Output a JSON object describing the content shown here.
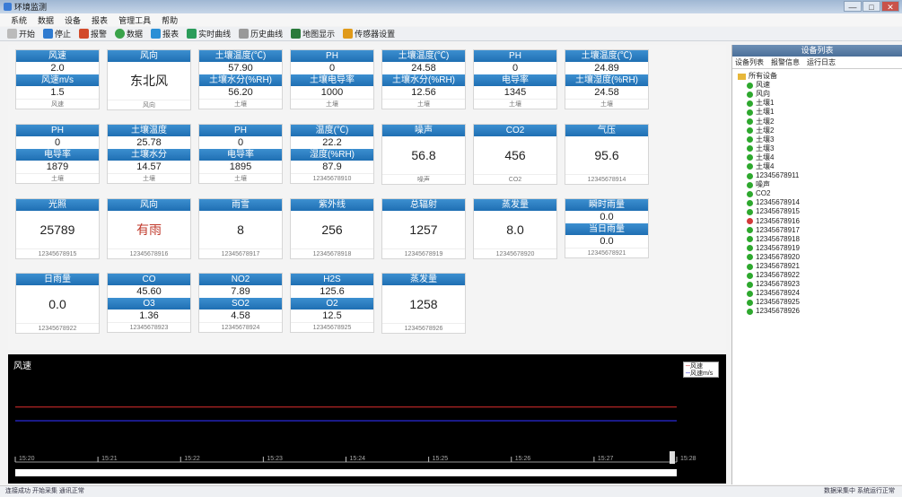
{
  "app": {
    "title": "环境监测",
    "window_buttons": [
      "—",
      "□",
      "✕"
    ]
  },
  "menu": [
    "系统",
    "数据",
    "设备",
    "报表",
    "管理工具",
    "帮助"
  ],
  "toolbar": {
    "start": "开始",
    "stop": "停止",
    "alarm": "报警",
    "data": "数据",
    "report": "报表",
    "curve": "实时曲线",
    "history": "历史曲线",
    "map": "地图显示",
    "settings": "传感器设置"
  },
  "cards": [
    {
      "rows": [
        [
          "h",
          "风速"
        ],
        [
          "v",
          "2.0"
        ],
        [
          "h",
          "风速m/s"
        ],
        [
          "v",
          "1.5"
        ],
        [
          "f",
          "风速"
        ]
      ]
    },
    {
      "rows": [
        [
          "h",
          "风向"
        ],
        [
          "big",
          "东北风"
        ],
        [
          "f",
          "风向"
        ]
      ]
    },
    {
      "rows": [
        [
          "h",
          "土壤温度(℃)"
        ],
        [
          "v",
          "57.90"
        ],
        [
          "h",
          "土壤水分(%RH)"
        ],
        [
          "v",
          "56.20"
        ],
        [
          "f",
          "土壤"
        ]
      ]
    },
    {
      "rows": [
        [
          "h",
          "PH"
        ],
        [
          "v",
          "0"
        ],
        [
          "h",
          "土壤电导率"
        ],
        [
          "v",
          "1000"
        ],
        [
          "f",
          "土壤"
        ]
      ]
    },
    {
      "rows": [
        [
          "h",
          "土壤温度(℃)"
        ],
        [
          "v",
          "24.58"
        ],
        [
          "h",
          "土壤水分(%RH)"
        ],
        [
          "v",
          "12.56"
        ],
        [
          "f",
          "土壤"
        ]
      ]
    },
    {
      "rows": [
        [
          "h",
          "PH"
        ],
        [
          "v",
          "0"
        ],
        [
          "h",
          "电导率"
        ],
        [
          "v",
          "1345"
        ],
        [
          "f",
          "土壤"
        ]
      ]
    },
    {
      "rows": [
        [
          "h",
          "土壤温度(℃)"
        ],
        [
          "v",
          "24.89"
        ],
        [
          "h",
          "土壤湿度(%RH)"
        ],
        [
          "v",
          "24.58"
        ],
        [
          "f",
          "土壤"
        ]
      ]
    },
    {
      "rows": [
        [
          "h",
          "PH"
        ],
        [
          "v",
          "0"
        ],
        [
          "h",
          "电导率"
        ],
        [
          "v",
          "1879"
        ],
        [
          "f",
          "土壤"
        ]
      ]
    },
    {
      "rows": [
        [
          "h",
          "土壤温度"
        ],
        [
          "v",
          "25.78"
        ],
        [
          "h",
          "土壤水分"
        ],
        [
          "v",
          "14.57"
        ],
        [
          "f",
          "土壤"
        ]
      ]
    },
    {
      "rows": [
        [
          "h",
          "PH"
        ],
        [
          "v",
          "0"
        ],
        [
          "h",
          "电导率"
        ],
        [
          "v",
          "1895"
        ],
        [
          "f",
          "土壤"
        ]
      ]
    },
    {
      "rows": [
        [
          "h",
          "温度(℃)"
        ],
        [
          "v",
          "22.2"
        ],
        [
          "h",
          "湿度(%RH)"
        ],
        [
          "v",
          "87.9"
        ],
        [
          "f",
          "12345678910"
        ]
      ]
    },
    {
      "rows": [
        [
          "h",
          "噪声"
        ],
        [
          "big",
          "56.8"
        ],
        [
          "f",
          "噪声"
        ]
      ]
    },
    {
      "rows": [
        [
          "h",
          "CO2"
        ],
        [
          "big",
          "456"
        ],
        [
          "f",
          "CO2"
        ]
      ]
    },
    {
      "rows": [
        [
          "h",
          "气压"
        ],
        [
          "big",
          "95.6"
        ],
        [
          "f",
          "12345678914"
        ]
      ]
    },
    {
      "rows": [
        [
          "h",
          "光照"
        ],
        [
          "big",
          "25789"
        ],
        [
          "f",
          "12345678915"
        ]
      ]
    },
    {
      "rows": [
        [
          "h",
          "风向"
        ],
        [
          "big",
          "有雨"
        ],
        [
          "f",
          "12345678916"
        ]
      ]
    },
    {
      "rows": [
        [
          "h",
          "雨雪"
        ],
        [
          "big",
          "8"
        ],
        [
          "f",
          "12345678917"
        ]
      ]
    },
    {
      "rows": [
        [
          "h",
          "紫外线"
        ],
        [
          "big",
          "256"
        ],
        [
          "f",
          "12345678918"
        ]
      ]
    },
    {
      "rows": [
        [
          "h",
          "总辐射"
        ],
        [
          "big",
          "1257"
        ],
        [
          "f",
          "12345678919"
        ]
      ]
    },
    {
      "rows": [
        [
          "h",
          "蒸发量"
        ],
        [
          "big",
          "8.0"
        ],
        [
          "f",
          "12345678920"
        ]
      ]
    },
    {
      "rows": [
        [
          "h",
          "瞬时雨量"
        ],
        [
          "v",
          "0.0"
        ],
        [
          "h",
          "当日雨量"
        ],
        [
          "v",
          "0.0"
        ],
        [
          "f",
          "12345678921"
        ]
      ]
    },
    {
      "rows": [
        [
          "h",
          "日雨量"
        ],
        [
          "big",
          "0.0"
        ],
        [
          "f",
          "12345678922"
        ]
      ]
    },
    {
      "rows": [
        [
          "h",
          "CO"
        ],
        [
          "v",
          "45.60"
        ],
        [
          "h",
          "O3"
        ],
        [
          "v",
          "1.36"
        ],
        [
          "f",
          "12345678923"
        ]
      ]
    },
    {
      "rows": [
        [
          "h",
          "NO2"
        ],
        [
          "v",
          "7.89"
        ],
        [
          "h",
          "SO2"
        ],
        [
          "v",
          "4.58"
        ],
        [
          "f",
          "12345678924"
        ]
      ]
    },
    {
      "rows": [
        [
          "h",
          "H2S"
        ],
        [
          "v",
          "125.6"
        ],
        [
          "h",
          "O2"
        ],
        [
          "v",
          "12.5"
        ],
        [
          "f",
          "12345678925"
        ]
      ]
    },
    {
      "rows": [
        [
          "h",
          "蒸发量"
        ],
        [
          "big",
          "1258"
        ],
        [
          "f",
          "12345678926"
        ]
      ]
    }
  ],
  "right_panel": {
    "title": "设备列表",
    "tabs": [
      "设备列表",
      "报警信息",
      "运行日志"
    ],
    "root": "所有设备",
    "items": [
      "风速",
      "风向",
      "土壤1",
      "土壤1",
      "土壤2",
      "土壤2",
      "土壤3",
      "土壤3",
      "土壤4",
      "土壤4",
      "12345678911",
      "噪声",
      "CO2",
      "12345678914",
      "12345678915",
      "12345678916",
      "12345678917",
      "12345678918",
      "12345678919",
      "12345678920",
      "12345678921",
      "12345678922",
      "12345678923",
      "12345678924",
      "12345678925",
      "12345678926"
    ],
    "red_index": 15
  },
  "chart_data": {
    "type": "line",
    "title": "风速",
    "series": [
      {
        "name": "风速",
        "values": [
          2.0,
          2.0
        ],
        "color": "#c62828"
      },
      {
        "name": "风速m/s",
        "values": [
          1.5,
          1.5
        ],
        "color": "#2a2ad8"
      }
    ],
    "x": [
      "15:20",
      "15:21",
      "15:22",
      "15:23",
      "15:24",
      "15:25",
      "15:26",
      "15:27",
      "15:28"
    ],
    "ylim": [
      0,
      3
    ],
    "grid": false
  },
  "status": {
    "left": "连接成功  开始采集  通讯正常",
    "right": "数据采集中  系统运行正常"
  }
}
